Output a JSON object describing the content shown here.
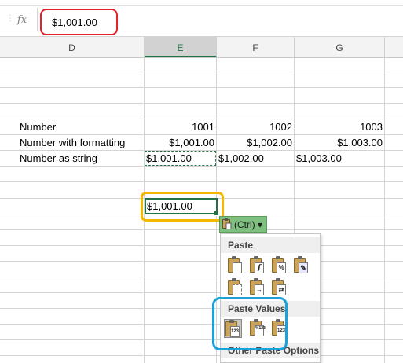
{
  "formula_bar": {
    "fx_label": "fx",
    "separator": "⋮",
    "value": "$1,001.00"
  },
  "columns": [
    "D",
    "E",
    "F",
    "G"
  ],
  "rows": [
    {
      "label": "Number",
      "e": "1001",
      "f": "1002",
      "g": "1003"
    },
    {
      "label": "Number with formatting",
      "e": "$1,001.00",
      "f": "$1,002.00",
      "g": "$1,003.00"
    },
    {
      "label": "Number as string",
      "e": "$1,001.00",
      "f": "$1,002.00",
      "g": "$1,003.00"
    }
  ],
  "active_cell": {
    "value": "$1,001.00"
  },
  "paste_options_button": {
    "label": "(Ctrl) ▾"
  },
  "paste_menu": {
    "paste_header": "Paste",
    "paste_icons": [
      "paste-icon",
      "paste-formulas-icon",
      "paste-formulas-number-formatting-icon",
      "keep-source-formatting-icon",
      "no-borders-icon",
      "keep-source-column-widths-icon",
      "transpose-icon"
    ],
    "paste_values_header": "Paste Values",
    "values_icons": [
      {
        "icon": "paste-values-icon",
        "text": "123"
      },
      {
        "icon": "paste-values-number-formatting-icon",
        "text": "%123"
      },
      {
        "icon": "paste-values-source-formatting-icon",
        "text": "123"
      }
    ],
    "other_header": "Other Paste Options"
  },
  "highlight_colors": {
    "formula": "#e3202b",
    "active_cell": "#f5b800",
    "paste_values": "#1aa3d9"
  },
  "accent": "#217346"
}
